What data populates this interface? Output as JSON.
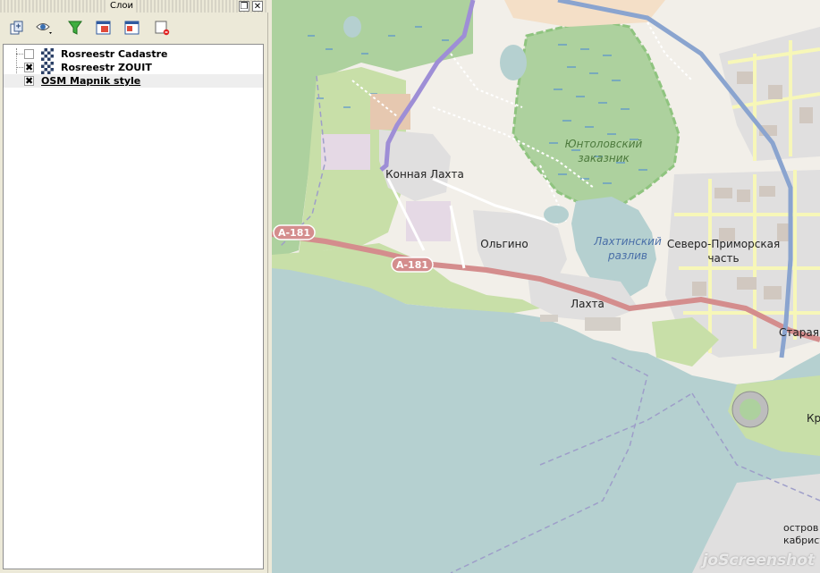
{
  "dock": {
    "title": "Слои",
    "float_glyph": "❐",
    "close_glyph": "✕"
  },
  "toolbar": [
    {
      "name": "add-group-icon"
    },
    {
      "name": "eye-icon"
    },
    {
      "name": "filter-icon"
    },
    {
      "name": "expand-all-icon"
    },
    {
      "name": "collapse-all-icon"
    },
    {
      "name": "remove-layer-icon"
    }
  ],
  "layers": [
    {
      "label": "Rosreestr Cadastre",
      "checked": false,
      "check_glyph": ""
    },
    {
      "label": "Rosreestr ZOUIT",
      "checked": true,
      "check_glyph": "✖"
    },
    {
      "label": "OSM Mapnik style",
      "checked": true,
      "check_glyph": "✖"
    }
  ],
  "map": {
    "labels": {
      "reserve_1": "Юнтоловский",
      "reserve_2": "заказник",
      "konnaya": "Конная Лахта",
      "olgino": "Ольгино",
      "lakhta": "Лахта",
      "razliv_1": "Лахтинский",
      "razliv_2": "разлив",
      "severo_1": "Северо-Приморская",
      "severo_2": "часть",
      "staraya": "Старая",
      "kr": "Кр",
      "island_1": "остров",
      "island_2": "кабрист",
      "road_1": "A-181",
      "road_2": "A-181"
    },
    "colors": {
      "water": "#b5d0d0",
      "land": "#f2efe9",
      "park": "#c8dfa8",
      "forest": "#add19e",
      "reserve_border": "#8fc47f",
      "road_primary": "#d48d8d",
      "motorway": "#8aa4cf",
      "tertiary": "#f7f7b8",
      "industrial": "#e5d9e5",
      "residential": "#e0dfdf",
      "boundary": "#9e9ec9"
    },
    "watermark": "joScreenshot"
  }
}
